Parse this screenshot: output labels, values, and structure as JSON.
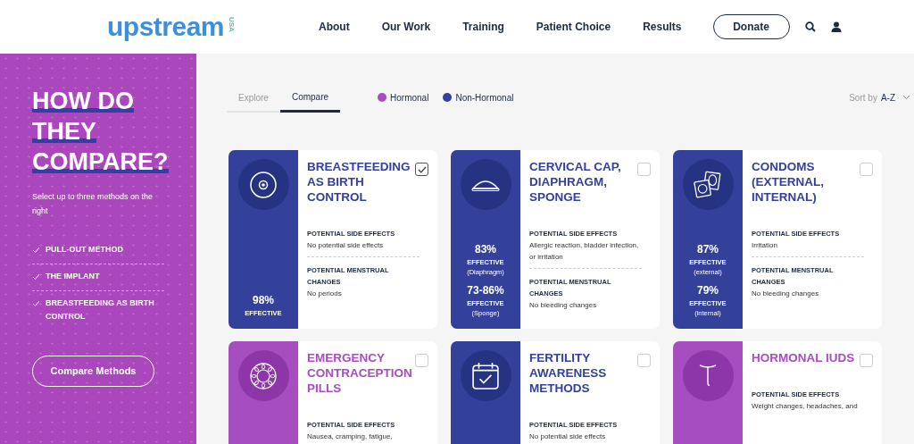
{
  "header": {
    "logo": "upstream",
    "logo_suffix": "USA",
    "nav": [
      "About",
      "Our Work",
      "Training",
      "Patient Choice",
      "Results"
    ],
    "donate": "Donate"
  },
  "sidebar": {
    "title": [
      "HOW DO",
      "THEY",
      "COMPARE?"
    ],
    "subtitle": "Select up to three methods on the right",
    "selected_methods": [
      {
        "label": "PULL-OUT METHOD",
        "checked": true
      },
      {
        "label": "THE IMPLANT",
        "checked": true
      },
      {
        "label": "BREASTFEEDING AS BIRTH CONTROL",
        "checked": true
      }
    ],
    "button": "Compare Methods"
  },
  "tabs": [
    {
      "label": "Explore",
      "selected": false
    },
    {
      "label": "Compare",
      "selected": true
    }
  ],
  "legend": [
    {
      "label": "Hormonal",
      "color": "#a64dbf"
    },
    {
      "label": "Non-Hormonal",
      "color": "#3440a0"
    }
  ],
  "sort": {
    "label": "Sort by",
    "value": "A-Z"
  },
  "cards": [
    {
      "kind": "non-hormonal",
      "title": "BREASTFEEDING AS BIRTH CONTROL",
      "checked": true,
      "effectiveness": [
        {
          "value": "98%",
          "label": "EFFECTIVE"
        }
      ],
      "side_effects_label": "POTENTIAL SIDE EFFECTS",
      "side_effects": "No potential side effects",
      "menstrual_label": "POTENTIAL MENSTRUAL CHANGES",
      "menstrual": "No periods"
    },
    {
      "kind": "non-hormonal",
      "title": "CERVICAL CAP, DIAPHRAGM, SPONGE",
      "checked": false,
      "effectiveness": [
        {
          "value": "83%",
          "label": "EFFECTIVE",
          "note": "(Diaphragm)"
        },
        {
          "value": "73-86%",
          "label": "EFFECTIVE",
          "note": "(Sponge)"
        }
      ],
      "side_effects_label": "POTENTIAL SIDE EFFECTS",
      "side_effects": "Allergic reaction, bladder infection, or irritation",
      "menstrual_label": "POTENTIAL MENSTRUAL CHANGES",
      "menstrual": "No bleeding changes"
    },
    {
      "kind": "non-hormonal",
      "title": "CONDOMS (EXTERNAL, INTERNAL)",
      "checked": false,
      "effectiveness": [
        {
          "value": "87%",
          "label": "EFFECTIVE",
          "note": "(external)"
        },
        {
          "value": "79%",
          "label": "EFFECTIVE",
          "note": "(internal)"
        }
      ],
      "side_effects_label": "POTENTIAL SIDE EFFECTS",
      "side_effects": "Irritation",
      "menstrual_label": "POTENTIAL MENSTRUAL CHANGES",
      "menstrual": "No bleeding changes"
    },
    {
      "kind": "hormonal",
      "title": "EMERGENCY CONTRACEPTION PILLS",
      "checked": false,
      "side_effects_label": "POTENTIAL SIDE EFFECTS",
      "side_effects": "Nausea, cramping, fatigue,"
    },
    {
      "kind": "non-hormonal",
      "title": "FERTILITY AWARENESS METHODS",
      "checked": false,
      "side_effects_label": "POTENTIAL SIDE EFFECTS",
      "side_effects": "No potential side effects"
    },
    {
      "kind": "hormonal",
      "title": "HORMONAL IUDS",
      "checked": false,
      "side_effects_label": "POTENTIAL SIDE EFFECTS",
      "side_effects": "Weight changes, headaches, and"
    }
  ]
}
